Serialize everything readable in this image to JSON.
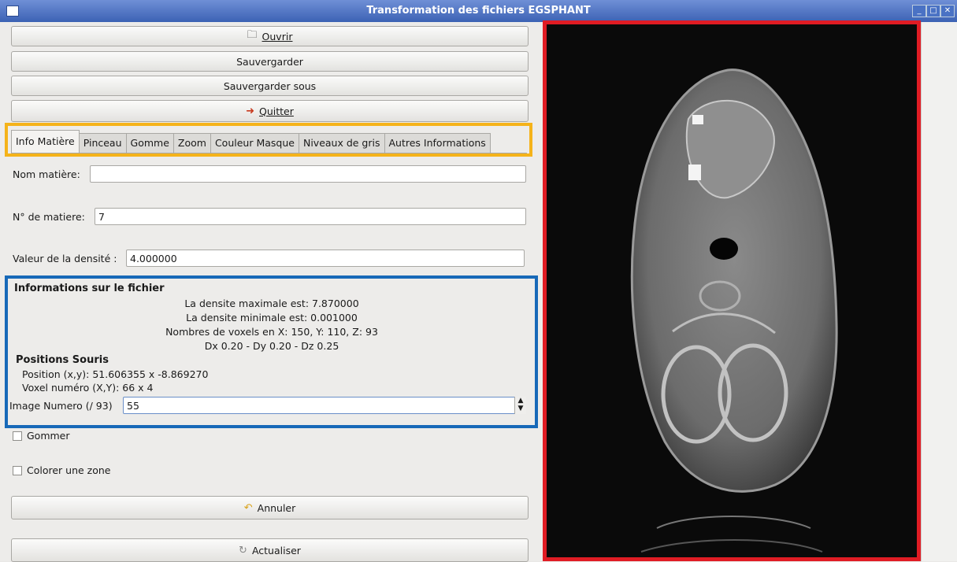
{
  "window": {
    "title": "Transformation des fichiers EGSPHANT"
  },
  "toolbar": {
    "open_label": "Ouvrir",
    "save_label": "Sauvergarder",
    "save_as_label": "Sauvergarder sous",
    "quit_label": "Quitter"
  },
  "tabs": [
    {
      "label": "Info Matière"
    },
    {
      "label": "Pinceau"
    },
    {
      "label": "Gomme"
    },
    {
      "label": "Zoom"
    },
    {
      "label": "Couleur Masque"
    },
    {
      "label": "Niveaux de gris"
    },
    {
      "label": "Autres Informations"
    }
  ],
  "form": {
    "material_name_label": "Nom matière:",
    "material_name_value": "",
    "material_number_label": "N° de matiere:",
    "material_number_value": "7",
    "density_label": "Valeur de la densité :",
    "density_value": "4.000000"
  },
  "file_info": {
    "title": "Informations sur le fichier",
    "max_density": "La densite maximale est: 7.870000",
    "min_density": "La densite minimale est: 0.001000",
    "voxels": "Nombres de voxels en X: 150, Y: 110, Z: 93",
    "spacing": "Dx 0.20 - Dy 0.20 - Dz 0.25"
  },
  "mouse": {
    "title": "Positions Souris",
    "position": "Position (x,y): 51.606355 x -8.869270",
    "voxel": "Voxel numéro (X,Y): 66 x 4"
  },
  "image_number": {
    "label": "Image Numero (/ 93)",
    "value": "55"
  },
  "options": {
    "erase_label": "Gommer",
    "color_zone_label": "Colorer une zone"
  },
  "actions": {
    "undo_label": "Annuler",
    "refresh_label": "Actualiser"
  },
  "colors": {
    "highlight_tabs": "#f5b31a",
    "highlight_info": "#1769b8",
    "highlight_image": "#e01c24"
  }
}
